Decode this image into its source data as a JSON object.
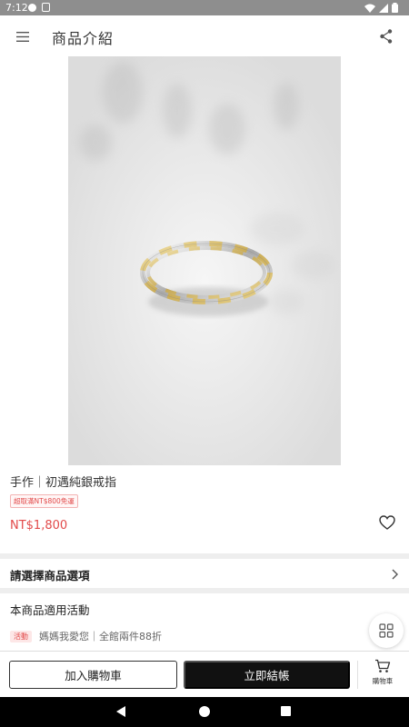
{
  "status_bar": {
    "time": "7:12"
  },
  "app_bar": {
    "title": "商品介紹"
  },
  "product": {
    "name": "手作｜初遇純銀戒指",
    "shipping_badge": "超取滿NT$800免運",
    "price": "NT$1,800"
  },
  "options": {
    "label": "請選擇商品選項"
  },
  "promotions": {
    "heading": "本商品適用活動",
    "items": [
      {
        "tag": "活動",
        "text": "媽媽我愛您｜全館兩件88折"
      }
    ]
  },
  "actions": {
    "add_to_cart": "加入購物車",
    "checkout": "立即結帳",
    "cart": "購物車"
  },
  "colors": {
    "accent": "#e24a4a",
    "primary_button": "#111111"
  }
}
